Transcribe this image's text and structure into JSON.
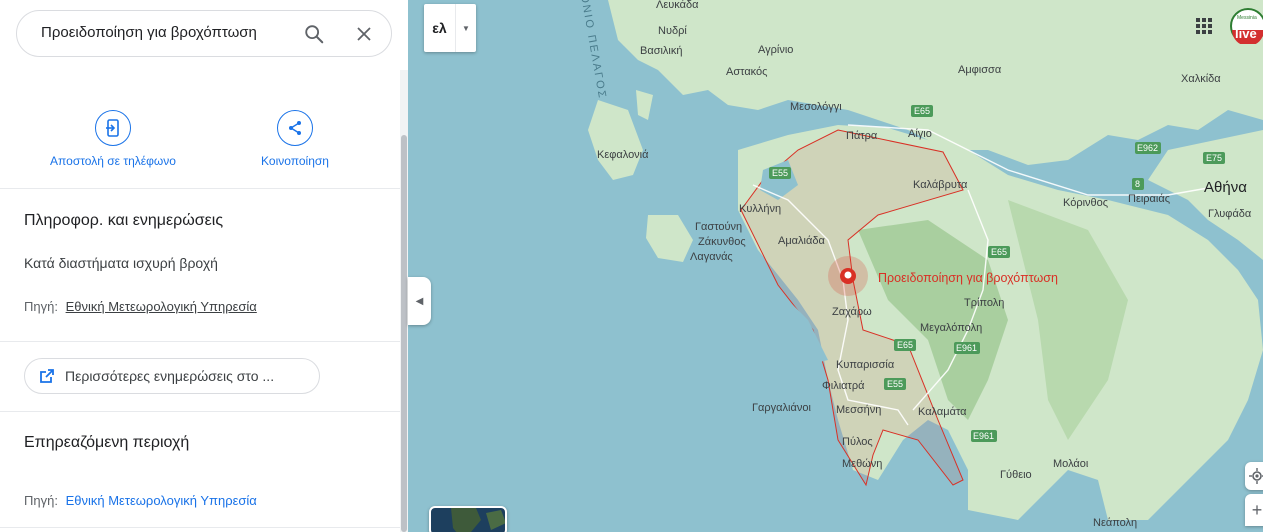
{
  "search": {
    "value": "Προειδοποίηση για βροχόπτωση"
  },
  "actions": {
    "send_label": "Αποστολή σε τηλέφωνο",
    "share_label": "Κοινοποίηση"
  },
  "info": {
    "heading": "Πληροφορ. και ενημερώσεις",
    "description": "Κατά διαστήματα ισχυρή βροχή",
    "source_label": "Πηγή:",
    "source_link": "Εθνική Μετεωρολογική Υπηρεσία"
  },
  "more_button": {
    "label": "Περισσότερες ενημερώσεις στο ..."
  },
  "affected": {
    "heading": "Επηρεαζόμενη περιοχή",
    "source_label": "Πηγή:",
    "source_link": "Εθνική Μετεωρολογική Υπηρεσία"
  },
  "map": {
    "language_button": "ελ",
    "warning_label": "Προειδοποίηση για βροχόπτωση",
    "sea_label": "ΙΟΝΙΟ ΠΕΛΑΓΟΣ",
    "logo_text": "live",
    "logo_top_text": "Messinia",
    "places": {
      "lefkada": "Λευκάδα",
      "nydri": "Νυδρί",
      "vasiliki": "Βασιλική",
      "agrinio": "Αγρίνιο",
      "astakos": "Αστακός",
      "mesolongi": "Μεσολόγγι",
      "amfissa": "Αμφισσα",
      "chalkida": "Χαλκίδα",
      "kefalonia": "Κεφαλονιά",
      "patra": "Πάτρα",
      "aigio": "Αίγιο",
      "kalavryta": "Καλάβρυτα",
      "athina": "Αθήνα",
      "korinthos": "Κόρινθος",
      "peiraias": "Πειραιάς",
      "glyfada": "Γλυφάδα",
      "kyllini": "Κυλλήνη",
      "gastouni": "Γαστούνη",
      "zakynthos": "Ζάκυνθος",
      "laganas": "Λαγανάς",
      "amaliada": "Αμαλιάδα",
      "tripoli": "Τρίπολη",
      "zacharo": "Ζαχάρω",
      "megalopoli": "Μεγαλόπολη",
      "kyparissia": "Κυπαρισσία",
      "filiatra": "Φιλιατρά",
      "gargalianoi": "Γαργαλιάνοι",
      "messini": "Μεσσήνη",
      "kalamata": "Καλαμάτα",
      "pylos": "Πύλος",
      "methoni": "Μεθώνη",
      "gytheio": "Γύθειο",
      "molaoi": "Μολάοι",
      "neapoli": "Νεάπολη"
    },
    "roads": [
      "E65",
      "E55",
      "E962",
      "E75",
      "8",
      "E65",
      "E65",
      "E961",
      "E55",
      "E961"
    ]
  },
  "colors": {
    "accent": "#1a73e8",
    "warning": "#d93025",
    "sea": "#8ec1cf",
    "land": "#cfe6c9"
  }
}
